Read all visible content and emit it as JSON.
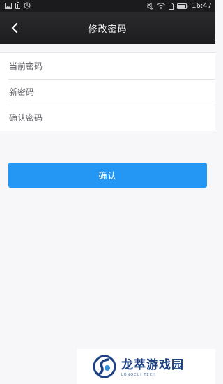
{
  "status_bar": {
    "time": "16:47",
    "left_icons": [
      "image-icon",
      "battery-saver-icon",
      "data-saver-icon"
    ],
    "right_icons": [
      "mute-icon",
      "wifi-icon",
      "sim-icon",
      "battery-icon"
    ]
  },
  "nav": {
    "title": "修改密码",
    "back_icon": "chevron-left-icon"
  },
  "form": {
    "current_password_placeholder": "当前密码",
    "new_password_placeholder": "新密码",
    "confirm_password_placeholder": "确认密码"
  },
  "confirm_button": {
    "label": "确认"
  },
  "watermark": {
    "name": "龙萃游戏园",
    "sub": "LONGCUI TECH"
  },
  "colors": {
    "status_bar": "#1b1b1d",
    "nav_bar": "#232326",
    "page_bg": "#f7f7f9",
    "primary": "#2496f3",
    "watermark_text": "#1a3f82"
  }
}
